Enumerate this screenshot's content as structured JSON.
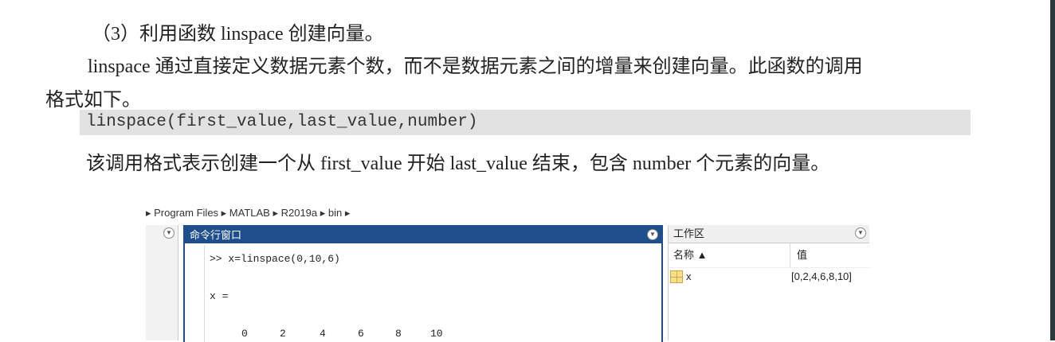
{
  "doc": {
    "heading": "（3）利用函数 linspace 创建向量。",
    "para_line1": "linspace  通过直接定义数据元素个数，而不是数据元素之间的增量来创建向量。此函数的调用",
    "para_line2": "格式如下。",
    "code": "linspace(first_value,last_value,number)",
    "description": "该调用格式表示创建一个从 first_value 开始 last_value 结束，包含 number 个元素的向量。"
  },
  "matlab": {
    "breadcrumb": "▸ Program Files ▸ MATLAB ▸ R2019a ▸ bin ▸",
    "command_window": {
      "title": "命令行窗口",
      "command": ">> x=linspace(0,10,6)",
      "output_label": "x =",
      "output_values": [
        "0",
        "2",
        "4",
        "6",
        "8",
        "10"
      ]
    },
    "workspace": {
      "title": "工作区",
      "col_name": "名称 ▲",
      "col_value": "值",
      "rows": [
        {
          "name": "x",
          "value": "[0,2,4,6,8,10]"
        }
      ]
    }
  }
}
